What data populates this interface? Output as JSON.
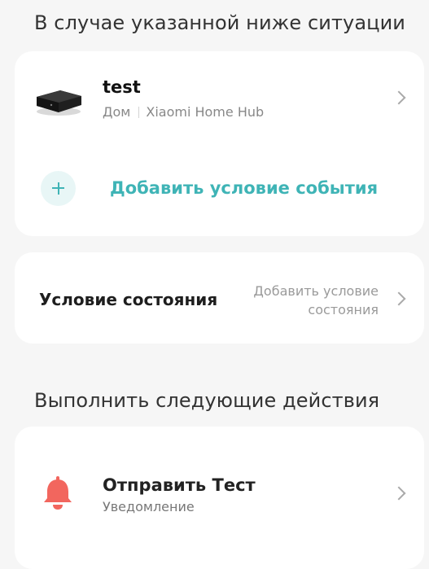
{
  "trigger_section": {
    "title": "В случае указанной ниже ситуации"
  },
  "device": {
    "name": "test",
    "room": "Дом",
    "hub": "Xiaomi Home Hub",
    "image": "device-hub-icon"
  },
  "add_event": {
    "label": "Добавить условие события",
    "icon": "plus-icon"
  },
  "state_condition": {
    "label": "Условие состояния",
    "value_line1": "Добавить условие",
    "value_line2": "состояния"
  },
  "actions_section": {
    "title": "Выполнить следующие действия"
  },
  "action": {
    "title": "Отправить Тест",
    "subtitle": "Уведомление",
    "icon": "bell-icon"
  },
  "colors": {
    "accent": "#3fb4b6",
    "bell": "#f2665e",
    "background": "#f6f6f6",
    "card": "#ffffff"
  }
}
